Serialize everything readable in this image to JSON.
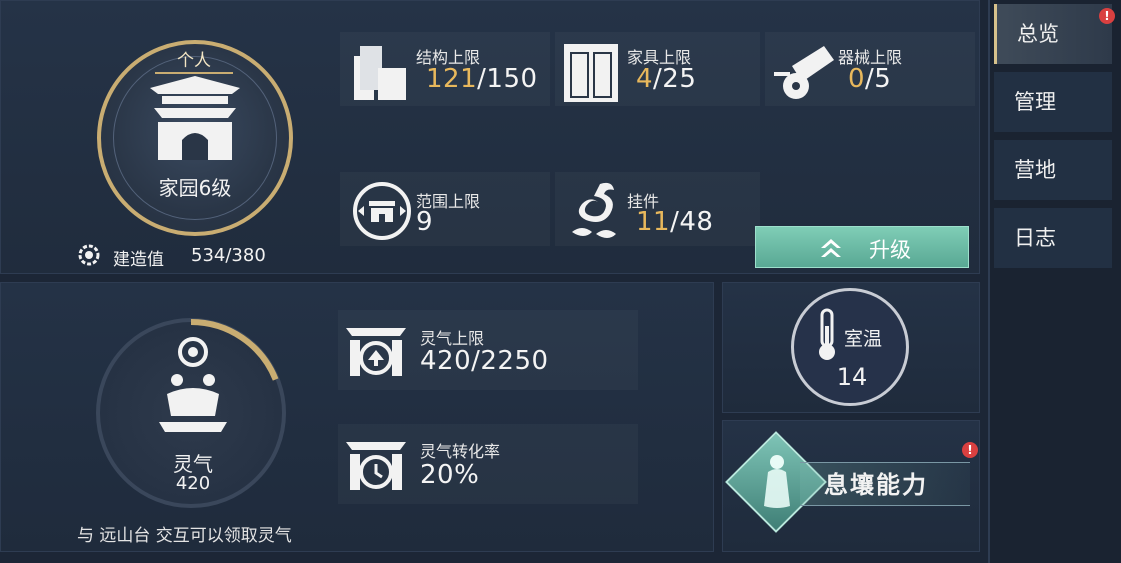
{
  "colors": {
    "accent_gold": "#e8b85c",
    "ring_gold": "#c9ad72",
    "upgrade_green": "#6bbba5",
    "alert_red": "#d94040"
  },
  "home": {
    "tag": "个人",
    "level_label": "家园6级",
    "build_label": "建造值",
    "build_value": "534/380"
  },
  "stats": {
    "structure": {
      "label": "结构上限",
      "current": "121",
      "max": "/150",
      "icon": "building-blocks-icon"
    },
    "furniture": {
      "label": "家具上限",
      "current": "4",
      "max": "/25",
      "icon": "wardrobe-icon"
    },
    "machinery": {
      "label": "器械上限",
      "current": "0",
      "max": "/5",
      "icon": "cannon-icon"
    },
    "range": {
      "label": "范围上限",
      "value": "9",
      "icon": "range-gate-icon"
    },
    "pendant": {
      "label": "挂件",
      "current": "11",
      "max": "/48",
      "icon": "dragon-pendant-icon"
    }
  },
  "upgrade": {
    "label": "升级"
  },
  "lingqi": {
    "name": "灵气",
    "value": "420",
    "progress": 0.19,
    "cap_label": "灵气上限",
    "cap_value": "420/2250",
    "rate_label": "灵气转化率",
    "rate_value": "20%",
    "hint": "与 远山台 交互可以领取灵气"
  },
  "temperature": {
    "label": "室温",
    "value": "14"
  },
  "ability": {
    "label": "息壤能力"
  },
  "sidebar": {
    "tabs": [
      {
        "label": "总览",
        "active": true,
        "alert": true
      },
      {
        "label": "管理",
        "active": false,
        "alert": false
      },
      {
        "label": "营地",
        "active": false,
        "alert": false
      },
      {
        "label": "日志",
        "active": false,
        "alert": false
      }
    ]
  }
}
